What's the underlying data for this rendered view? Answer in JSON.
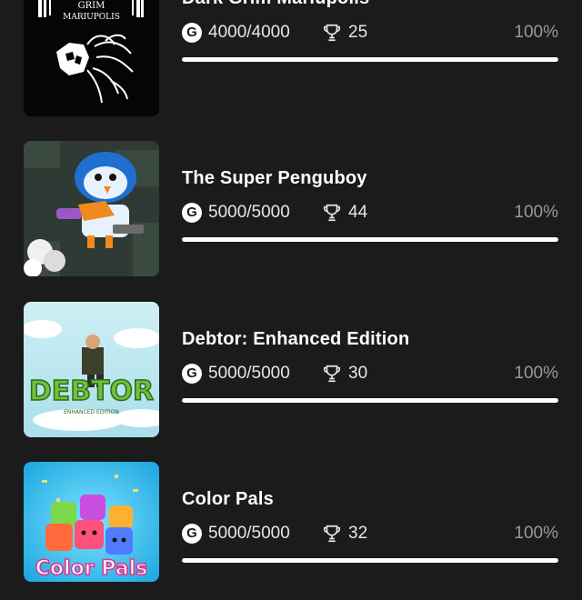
{
  "games": [
    {
      "title": "Dark Grim Mariupolis",
      "cover_text_top": "GRIM",
      "cover_text_bottom": "MARIUPOLIS",
      "gamerscore": "4000/4000",
      "achievements": "25",
      "percent_label": "100%",
      "progress": 1.0,
      "g_icon_label": "G"
    },
    {
      "title": "The Super Penguboy",
      "gamerscore": "5000/5000",
      "achievements": "44",
      "percent_label": "100%",
      "progress": 1.0,
      "g_icon_label": "G"
    },
    {
      "title": "Debtor: Enhanced Edition",
      "cover_text": "DEBTOR",
      "cover_subtext": "ENHANCED EDITION",
      "gamerscore": "5000/5000",
      "achievements": "30",
      "percent_label": "100%",
      "progress": 1.0,
      "g_icon_label": "G"
    },
    {
      "title": "Color Pals",
      "cover_text": "Color Pals",
      "gamerscore": "5000/5000",
      "achievements": "32",
      "percent_label": "100%",
      "progress": 1.0,
      "g_icon_label": "G"
    }
  ],
  "colors": {
    "background": "#1b1b1b",
    "progress_fill": "#ffffff",
    "progress_track": "#3a3a3a",
    "percent_text": "#9a9a9a"
  },
  "icons": {
    "gamerscore": "gamerscore-icon",
    "achievements": "trophy-icon"
  }
}
